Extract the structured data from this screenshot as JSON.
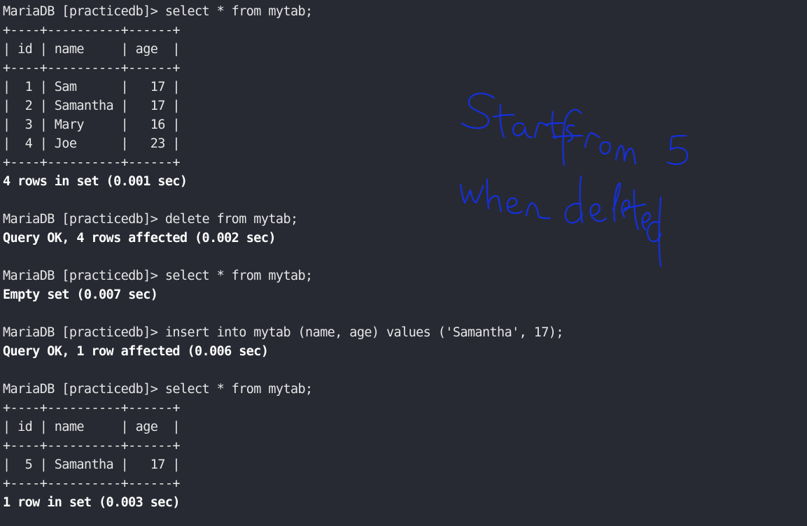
{
  "terminal": {
    "lines": [
      {
        "text": "MariaDB [practicedb]> select * from mytab;",
        "kind": "prompt"
      },
      {
        "text": "+----+----------+------+",
        "kind": "border"
      },
      {
        "text": "| id | name     | age  |",
        "kind": "row"
      },
      {
        "text": "+----+----------+------+",
        "kind": "border"
      },
      {
        "text": "|  1 | Sam      |   17 |",
        "kind": "row"
      },
      {
        "text": "|  2 | Samantha |   17 |",
        "kind": "row"
      },
      {
        "text": "|  3 | Mary     |   16 |",
        "kind": "row"
      },
      {
        "text": "|  4 | Joe      |   23 |",
        "kind": "row"
      },
      {
        "text": "+----+----------+------+",
        "kind": "border"
      },
      {
        "text": "4 rows in set (0.001 sec)",
        "kind": "output"
      },
      {
        "text": "",
        "kind": "blank"
      },
      {
        "text": "MariaDB [practicedb]> delete from mytab;",
        "kind": "prompt"
      },
      {
        "text": "Query OK, 4 rows affected (0.002 sec)",
        "kind": "output"
      },
      {
        "text": "",
        "kind": "blank"
      },
      {
        "text": "MariaDB [practicedb]> select * from mytab;",
        "kind": "prompt"
      },
      {
        "text": "Empty set (0.007 sec)",
        "kind": "output"
      },
      {
        "text": "",
        "kind": "blank"
      },
      {
        "text": "MariaDB [practicedb]> insert into mytab (name, age) values ('Samantha', 17);",
        "kind": "prompt"
      },
      {
        "text": "Query OK, 1 row affected (0.006 sec)",
        "kind": "output"
      },
      {
        "text": "",
        "kind": "blank"
      },
      {
        "text": "MariaDB [practicedb]> select * from mytab;",
        "kind": "prompt"
      },
      {
        "text": "+----+----------+------+",
        "kind": "border"
      },
      {
        "text": "| id | name     | age  |",
        "kind": "row"
      },
      {
        "text": "+----+----------+------+",
        "kind": "border"
      },
      {
        "text": "|  5 | Samantha |   17 |",
        "kind": "row"
      },
      {
        "text": "+----+----------+------+",
        "kind": "border"
      },
      {
        "text": "1 row in set (0.003 sec)",
        "kind": "output"
      }
    ]
  },
  "annotation": {
    "text_line_1": "Starts from 5",
    "text_line_2": "when deleted",
    "color": "#1430e0"
  },
  "colors": {
    "background": "#282a33",
    "text": "#e6e6e6"
  }
}
